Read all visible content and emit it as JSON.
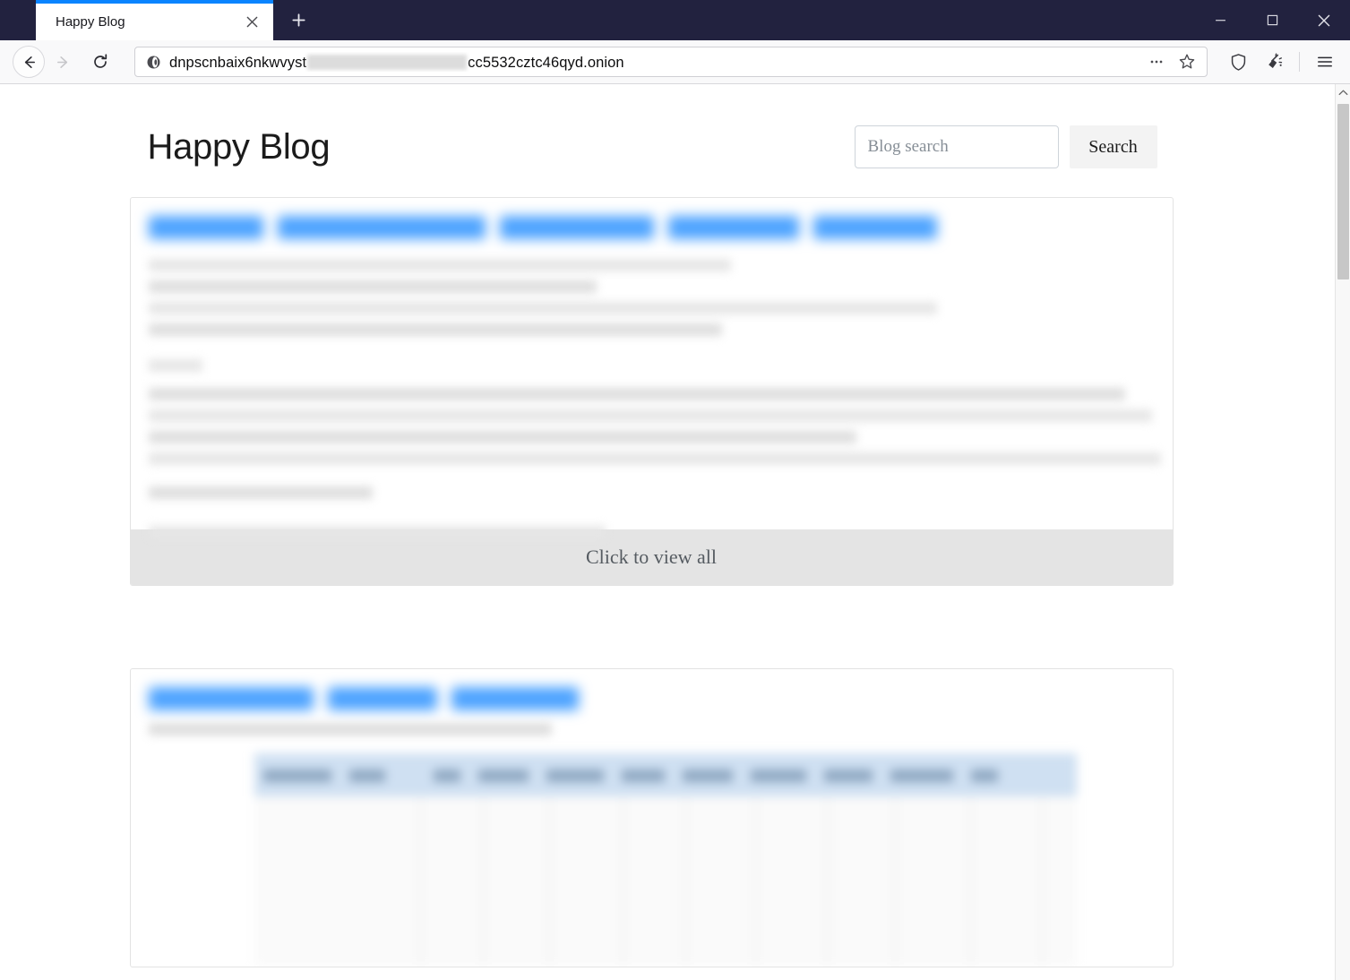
{
  "browser": {
    "tab": {
      "title": "Happy Blog",
      "close_icon": "close-icon",
      "favicon": "none"
    },
    "new_tab_icon": "plus-icon",
    "window_controls": {
      "minimize": "minimize-icon",
      "maximize": "maximize-icon",
      "close": "close-icon"
    },
    "nav": {
      "back_icon": "arrow-left-icon",
      "forward_icon": "arrow-right-icon",
      "reload_icon": "reload-icon"
    },
    "urlbar": {
      "site_icon": "onion-icon",
      "url_prefix": "dnpscnbaix6nkwvyst",
      "url_redacted": "",
      "url_suffix": "cc5532cztc46qyd.onion",
      "page_actions_icon": "ellipsis-icon",
      "bookmark_icon": "star-icon"
    },
    "toolbar": {
      "shield_icon": "shield-icon",
      "new_identity_icon": "broom-icon",
      "menu_icon": "hamburger-menu-icon"
    },
    "scrollbar": {
      "up_arrow_icon": "chevron-up-icon",
      "down_arrow_icon": "chevron-down-icon"
    }
  },
  "page": {
    "site_title": "Happy Blog",
    "search": {
      "placeholder": "Blog search",
      "value": "",
      "button_label": "Search"
    },
    "posts": [
      {
        "title_redacted": true,
        "title_segments": [
          230,
          250,
          130,
          190,
          150
        ],
        "body_redacted": true,
        "footer_label": "Click to view all",
        "has_footer": true,
        "has_table_image": false
      },
      {
        "title_redacted": true,
        "title_segments": [
          190,
          130,
          150
        ],
        "body_redacted": true,
        "footer_label": "Click to view all",
        "has_footer": false,
        "has_table_image": true
      }
    ]
  },
  "colors": {
    "chrome_bg": "#22223f",
    "tab_active_accent": "#0a84ff",
    "navbar_bg": "#f9f9fa",
    "link_blue": "#4da3ff",
    "card_border": "#e3e3e3",
    "footer_bg": "#e4e4e4",
    "footer_text": "#555b61",
    "scrollbar_thumb": "#c7c7c7"
  }
}
